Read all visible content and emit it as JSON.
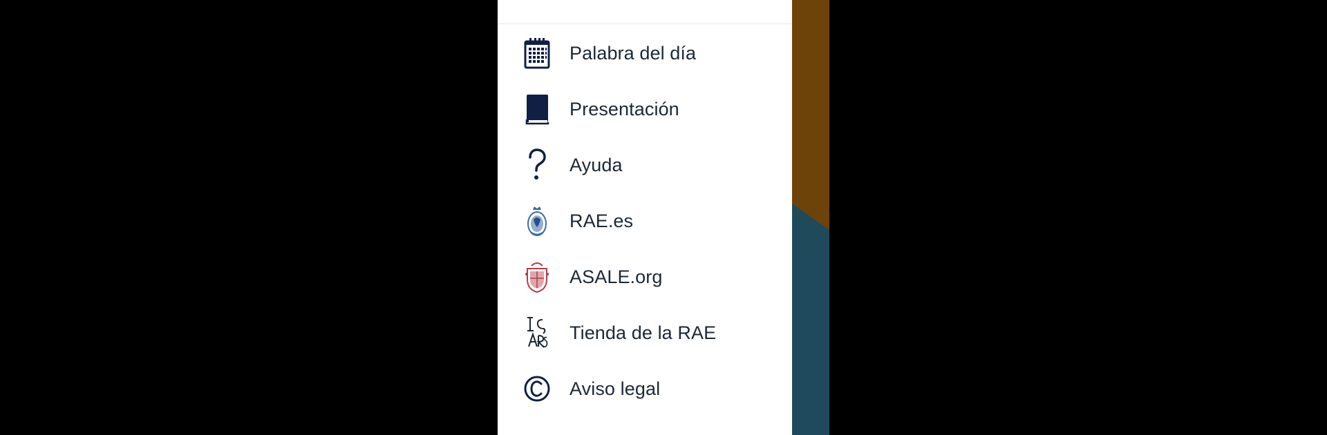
{
  "colors": {
    "screen_background": "#000000",
    "drawer_background": "#ffffff",
    "icon_navy": "#0f1f45",
    "text": "#1c2736",
    "divider": "#e3e6ea",
    "backdrop_brown": "#6d430a",
    "backdrop_teal": "#1f4a5c",
    "emblem_blue": "#3d6ba8",
    "emblem_red": "#b73b45"
  },
  "drawer": {
    "menu": [
      {
        "label": "Palabra del día",
        "icon": "calendar-icon"
      },
      {
        "label": "Presentación",
        "icon": "book-icon"
      },
      {
        "label": "Ayuda",
        "icon": "question-mark-icon"
      },
      {
        "label": "RAE.es",
        "icon": "rae-emblem-icon"
      },
      {
        "label": "ASALE.org",
        "icon": "asale-emblem-icon"
      },
      {
        "label": "Tienda de la RAE",
        "icon": "tienda-logo-icon"
      },
      {
        "label": "Aviso legal",
        "icon": "copyright-icon"
      }
    ]
  }
}
